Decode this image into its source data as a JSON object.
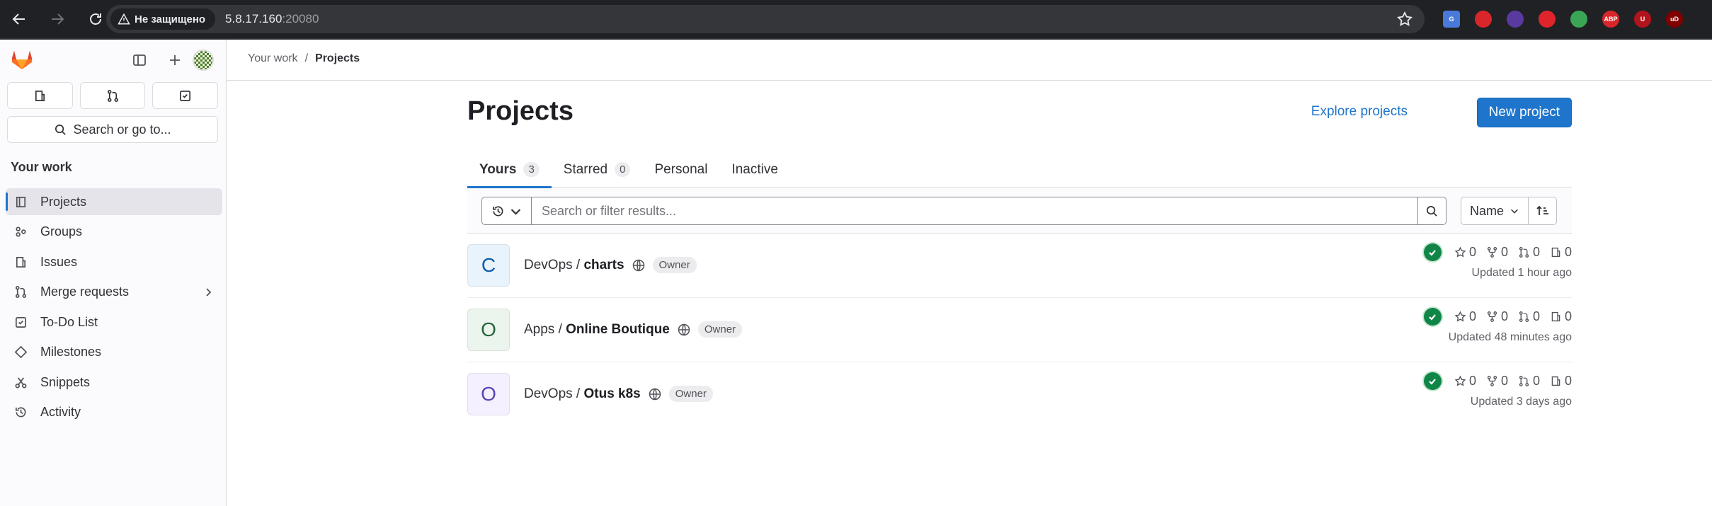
{
  "browser": {
    "security_label": "Не защищено",
    "url_host": "5.8.17.160",
    "url_port": ":20080",
    "extensions": [
      {
        "name": "translate",
        "color": "#4a7ad9",
        "text": "G"
      },
      {
        "name": "red-circle",
        "color": "#d9262a",
        "text": ""
      },
      {
        "name": "purple-ext",
        "color": "#5b3aa0",
        "text": ""
      },
      {
        "name": "red-hand",
        "color": "#e0242b",
        "text": ""
      },
      {
        "name": "puzzle-color",
        "color": "#3aa655",
        "text": ""
      },
      {
        "name": "adblock-plus",
        "color": "#d9262a",
        "text": "ABP"
      },
      {
        "name": "u-ext",
        "color": "#b1141c",
        "text": "U"
      },
      {
        "name": "ublock",
        "color": "#800000",
        "text": "uD"
      }
    ]
  },
  "sidebar": {
    "search_label": "Search or go to...",
    "section_title": "Your work",
    "items": [
      {
        "label": "Projects",
        "icon": "project-icon"
      },
      {
        "label": "Groups",
        "icon": "group-icon"
      },
      {
        "label": "Issues",
        "icon": "issues-icon"
      },
      {
        "label": "Merge requests",
        "icon": "merge-request-icon"
      },
      {
        "label": "To-Do List",
        "icon": "todo-icon"
      },
      {
        "label": "Milestones",
        "icon": "milestone-icon"
      },
      {
        "label": "Snippets",
        "icon": "snippet-icon"
      },
      {
        "label": "Activity",
        "icon": "history-icon"
      }
    ]
  },
  "breadcrumb": {
    "parent": "Your work",
    "separator": "/",
    "current": "Projects"
  },
  "main": {
    "title": "Projects",
    "explore_label": "Explore projects",
    "new_project_label": "New project",
    "tabs": [
      {
        "label": "Yours",
        "count": "3"
      },
      {
        "label": "Starred",
        "count": "0"
      },
      {
        "label": "Personal",
        "count": null
      },
      {
        "label": "Inactive",
        "count": null
      }
    ],
    "search_placeholder": "Search or filter results...",
    "sort_label": "Name"
  },
  "projects": [
    {
      "initial": "C",
      "avatar_bg": "#e9f3fc",
      "initial_color": "#0b5cad",
      "namespace": "DevOps",
      "name": "charts",
      "role": "Owner",
      "stars": "0",
      "forks": "0",
      "merge_requests": "0",
      "issues": "0",
      "updated": "Updated 1 hour ago"
    },
    {
      "initial": "O",
      "avatar_bg": "#ecf4ee",
      "initial_color": "#24663b",
      "namespace": "Apps",
      "name": "Online Boutique",
      "role": "Owner",
      "stars": "0",
      "forks": "0",
      "merge_requests": "0",
      "issues": "0",
      "updated": "Updated 48 minutes ago"
    },
    {
      "initial": "O",
      "avatar_bg": "#f4f0ff",
      "initial_color": "#5943b6",
      "namespace": "DevOps",
      "name": "Otus k8s",
      "role": "Owner",
      "stars": "0",
      "forks": "0",
      "merge_requests": "0",
      "issues": "0",
      "updated": "Updated 3 days ago"
    }
  ]
}
